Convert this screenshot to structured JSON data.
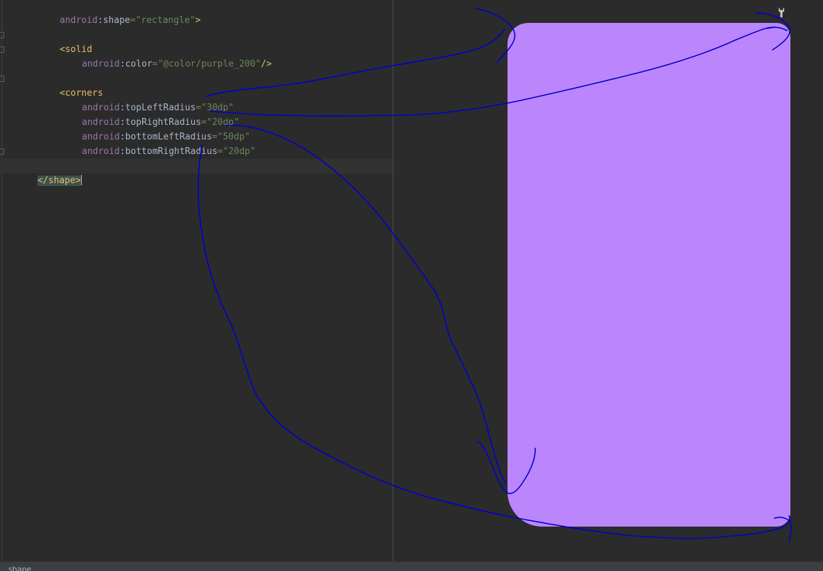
{
  "editor": {
    "lines": [
      {
        "attr_ns": "android",
        "attr_name": "shape",
        "eq": "=",
        "value": "\"rectangle\"",
        "close": ">"
      },
      {
        "open_tag": "<solid"
      },
      {
        "attr_ns": "android",
        "attr_name": "color",
        "eq": "=",
        "value": "\"@color/purple_200\"",
        "close": "/>"
      },
      {
        "open_tag": "<corners"
      },
      {
        "attr_ns": "android",
        "attr_name": "topLeftRadius",
        "eq": "=",
        "value": "\"30dp\""
      },
      {
        "attr_ns": "android",
        "attr_name": "topRightRadius",
        "eq": "=",
        "value": "\"20dp\""
      },
      {
        "attr_ns": "android",
        "attr_name": "bottomLeftRadius",
        "eq": "=",
        "value": "\"50dp\""
      },
      {
        "attr_ns": "android",
        "attr_name": "bottomRightRadius",
        "eq": "=",
        "value": "\"20dp\""
      },
      {
        "self_close": "/>"
      },
      {
        "close_tag": "</shape>"
      }
    ],
    "colon": ":"
  },
  "preview": {
    "shape_color": "#bb86fc",
    "wrench_icon": "wrench-icon"
  },
  "annotation": {
    "ink_color": "#0000cc"
  },
  "statusbar": {
    "breadcrumb": "shape"
  }
}
